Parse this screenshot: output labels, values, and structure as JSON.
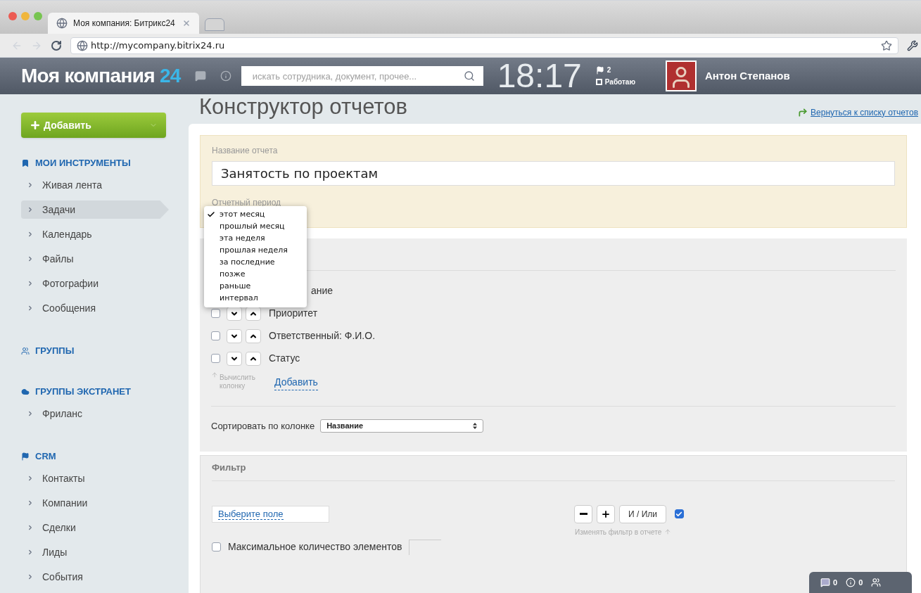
{
  "browser": {
    "tab_title": "Моя компания: Битрикс24",
    "url": "http://mycompany.bitrix24.ru"
  },
  "header": {
    "logo": "Моя компания",
    "logo_number": "24",
    "search": {
      "placeholder": "искать сотрудника, документ, прочее..."
    },
    "time": "18:17",
    "flags": "2",
    "status": "Работаю",
    "user_name": "Антон Степанов"
  },
  "sidebar": {
    "add_button": "Добавить",
    "sections": [
      {
        "title": "МОИ ИНСТРУМЕНТЫ",
        "kind": "tools",
        "items": [
          {
            "label": "Живая лента",
            "selected": false
          },
          {
            "label": "Задачи",
            "selected": true
          },
          {
            "label": "Календарь",
            "selected": false
          },
          {
            "label": "Файлы",
            "selected": false
          },
          {
            "label": "Фотографии",
            "selected": false
          },
          {
            "label": "Сообщения",
            "selected": false
          }
        ]
      },
      {
        "title": "ГРУППЫ",
        "kind": "groups"
      },
      {
        "title": "ГРУППЫ ЭКСТРАНЕТ",
        "kind": "extranet",
        "items": [
          {
            "label": "Фриланс",
            "selected": false
          }
        ]
      },
      {
        "title": "CRM",
        "kind": "crm",
        "items": [
          {
            "label": "Контакты",
            "selected": false
          },
          {
            "label": "Компании",
            "selected": false
          },
          {
            "label": "Сделки",
            "selected": false
          },
          {
            "label": "Лиды",
            "selected": false
          },
          {
            "label": "События",
            "selected": false
          }
        ]
      }
    ]
  },
  "page": {
    "title": "Конструктор отчетов",
    "back_link": "Вернуться к списку отчетов"
  },
  "report": {
    "name_label": "Название отчета",
    "name_value": "Занятость по проектам",
    "period_label": "Отчетный период",
    "period_options": [
      {
        "label": "этот месяц",
        "selected": true
      },
      {
        "label": "прошлый месяц",
        "selected": false
      },
      {
        "label": "эта неделя",
        "selected": false
      },
      {
        "label": "прошлая неделя",
        "selected": false
      },
      {
        "label": "за последние",
        "selected": false
      },
      {
        "label": "позже",
        "selected": false
      },
      {
        "label": "раньше",
        "selected": false
      },
      {
        "label": "интервал",
        "selected": false
      }
    ]
  },
  "columns": {
    "rows": [
      {
        "kind": "partial",
        "label": "ание"
      },
      {
        "kind": "full",
        "label": "Приоритет",
        "checked": false
      },
      {
        "kind": "full",
        "label": "Ответственный: Ф.И.О.",
        "checked": false
      },
      {
        "kind": "full",
        "label": "Статус",
        "checked": false
      }
    ],
    "compute_hint": "Вычислить колонку",
    "add_link": "Добавить",
    "sort_label": "Сортировать по колонке",
    "sort_value": "Название"
  },
  "filter": {
    "title": "Фильтр",
    "field_link": "Выберите поле",
    "and_or": "И / Или",
    "change_checked": true,
    "change_hint": "Изменять фильтр в отчете",
    "max_label": "Максимальное количество элементов",
    "max_checked": false
  },
  "widget": {
    "messages": "0",
    "notifications": "0"
  }
}
